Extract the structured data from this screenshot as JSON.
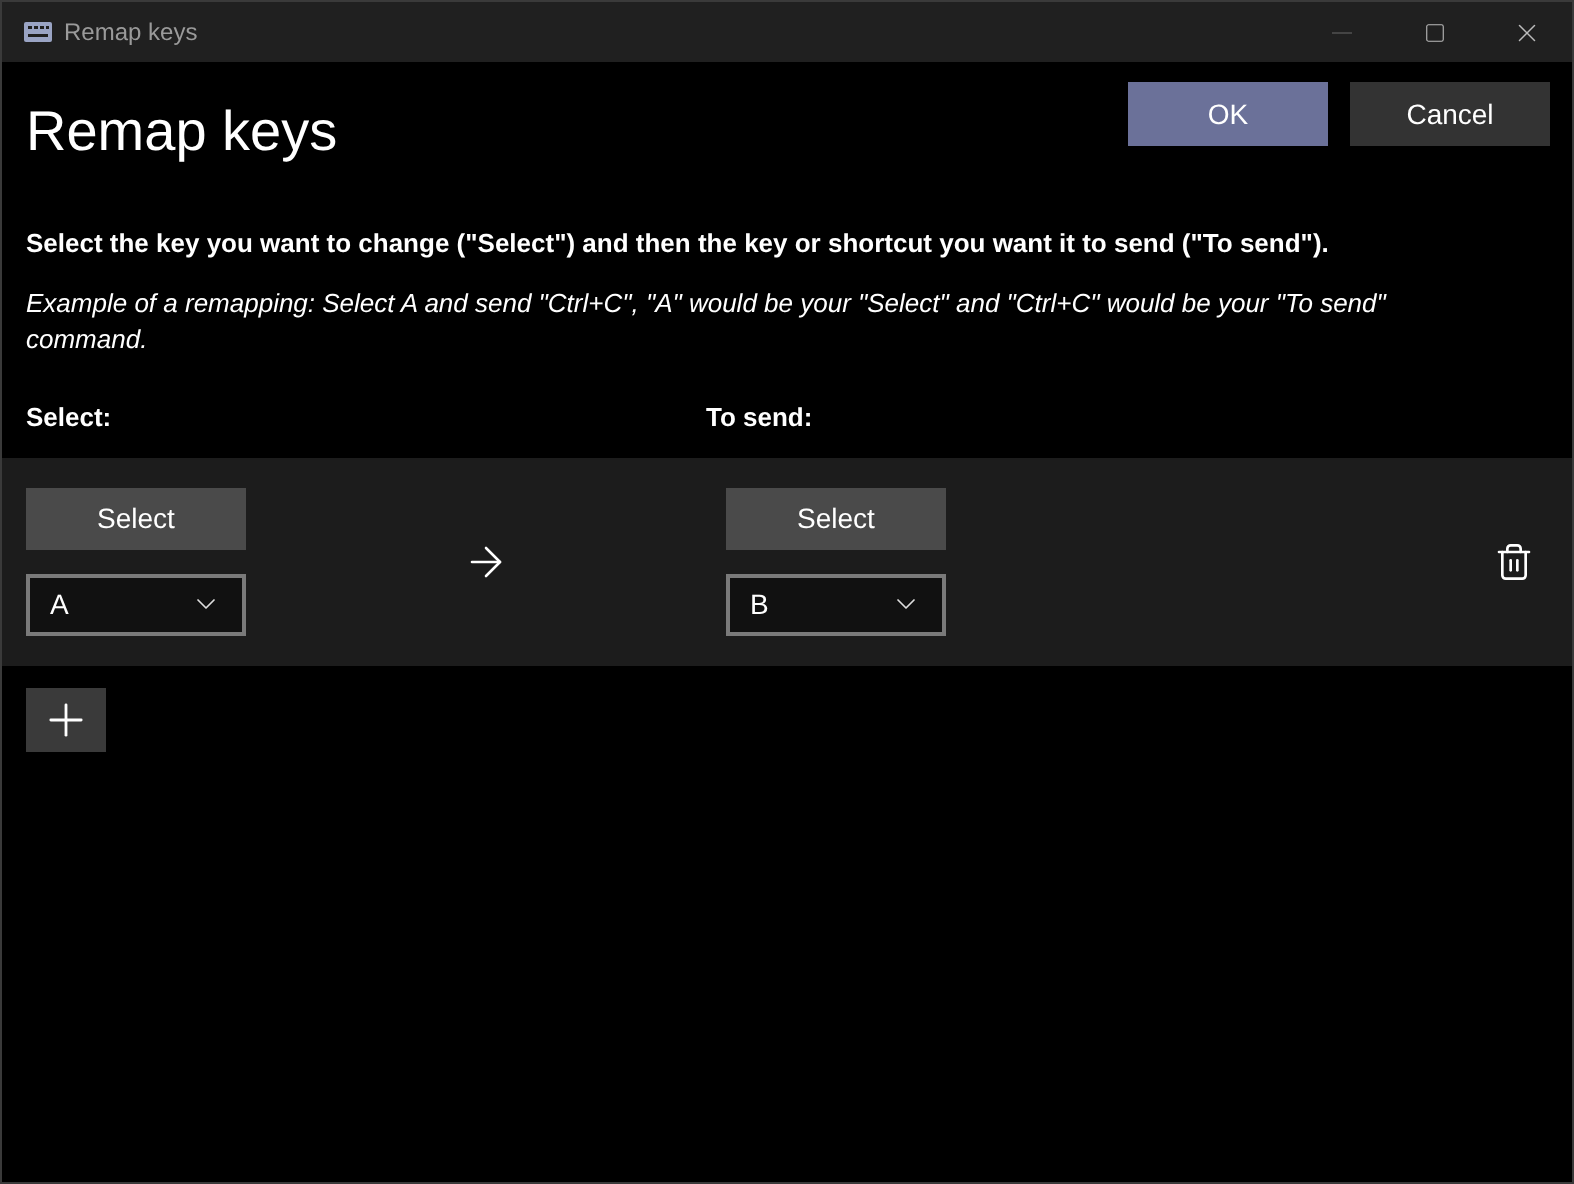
{
  "window": {
    "title": "Remap keys"
  },
  "header": {
    "title": "Remap keys",
    "buttons": [
      {
        "label": "OK",
        "kind": "primary"
      },
      {
        "label": "Cancel",
        "kind": "secondary"
      }
    ]
  },
  "instructions": "Select the key you want to change (\"Select\") and then the key or shortcut you want it to send (\"To send\").",
  "example": "Example of a remapping: Select A and send \"Ctrl+C\", \"A\" would be your \"Select\" and \"Ctrl+C\" would be your \"To send\" command.",
  "columns": {
    "select": "Select:",
    "to_send": "To send:"
  },
  "mappings": [
    {
      "select_button": "Select",
      "from_key": "A",
      "to_button": "Select",
      "to_key": "B"
    }
  ]
}
